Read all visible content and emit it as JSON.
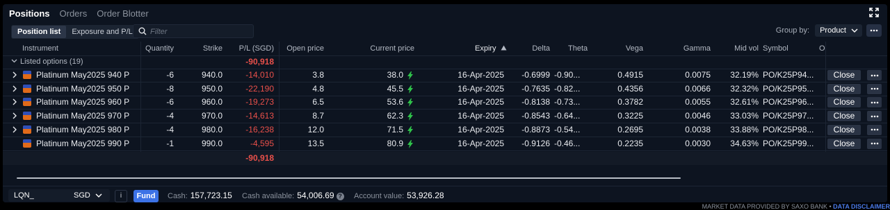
{
  "tabs": [
    "Positions",
    "Orders",
    "Order Blotter"
  ],
  "toolbar": {
    "segments": [
      "Position list",
      "Exposure and P/L"
    ],
    "filter_placeholder": "Filter",
    "group_by_label": "Group by:",
    "group_by_value": "Product"
  },
  "columns": {
    "instrument": "Instrument",
    "quantity": "Quantity",
    "strike": "Strike",
    "pl": "P/L (SGD)",
    "open_price": "Open price",
    "current_price": "Current price",
    "expiry": "Expiry",
    "delta": "Delta",
    "theta": "Theta",
    "vega": "Vega",
    "gamma": "Gamma",
    "mid_vol": "Mid vol",
    "symbol": "Symbol",
    "extra": "O"
  },
  "group": {
    "label": "Listed options (19)",
    "pl": "-90,918"
  },
  "rows": [
    {
      "instrument": "Platinum May2025 940 P",
      "quantity": "-6",
      "strike": "940.0",
      "pl": "-14,010",
      "open": "3.8",
      "current": "38.0",
      "expiry": "16-Apr-2025",
      "delta": "-0.6999",
      "theta": "-0.90...",
      "vega": "0.4915",
      "gamma": "0.0075",
      "midvol": "32.19%",
      "symbol": "PO/K25P94...",
      "close": "Close"
    },
    {
      "instrument": "Platinum May2025 950 P",
      "quantity": "-8",
      "strike": "950.0",
      "pl": "-22,190",
      "open": "4.8",
      "current": "45.5",
      "expiry": "16-Apr-2025",
      "delta": "-0.7635",
      "theta": "-0.82...",
      "vega": "0.4356",
      "gamma": "0.0066",
      "midvol": "32.32%",
      "symbol": "PO/K25P95...",
      "close": "Close"
    },
    {
      "instrument": "Platinum May2025 960 P",
      "quantity": "-6",
      "strike": "960.0",
      "pl": "-19,273",
      "open": "6.5",
      "current": "53.6",
      "expiry": "16-Apr-2025",
      "delta": "-0.8138",
      "theta": "-0.73...",
      "vega": "0.3782",
      "gamma": "0.0055",
      "midvol": "32.61%",
      "symbol": "PO/K25P96...",
      "close": "Close"
    },
    {
      "instrument": "Platinum May2025 970 P",
      "quantity": "-4",
      "strike": "970.0",
      "pl": "-14,613",
      "open": "8.7",
      "current": "62.3",
      "expiry": "16-Apr-2025",
      "delta": "-0.8543",
      "theta": "-0.64...",
      "vega": "0.3225",
      "gamma": "0.0046",
      "midvol": "33.03%",
      "symbol": "PO/K25P97...",
      "close": "Close"
    },
    {
      "instrument": "Platinum May2025 980 P",
      "quantity": "-4",
      "strike": "980.0",
      "pl": "-16,238",
      "open": "12.0",
      "current": "71.5",
      "expiry": "16-Apr-2025",
      "delta": "-0.8873",
      "theta": "-0.54...",
      "vega": "0.2695",
      "gamma": "0.0038",
      "midvol": "33.88%",
      "symbol": "PO/K25P98...",
      "close": "Close"
    },
    {
      "instrument": "Platinum May2025 990 P",
      "quantity": "-1",
      "strike": "990.0",
      "pl": "-4,595",
      "open": "13.5",
      "current": "80.9",
      "expiry": "16-Apr-2025",
      "delta": "-0.9126",
      "theta": "-0.46...",
      "vega": "0.2235",
      "gamma": "0.0030",
      "midvol": "34.63%",
      "symbol": "PO/K25P99...",
      "close": "Close"
    }
  ],
  "total_pl": "-90,918",
  "footer": {
    "account_id": "LQN_",
    "currency": "SGD",
    "info_label": "i",
    "fund_label": "Fund",
    "cash_label": "Cash:",
    "cash_value": "157,723.15",
    "cash_available_label": "Cash available:",
    "cash_available_value": "54,006.69",
    "account_value_label": "Account value:",
    "account_value_value": "53,926.28"
  },
  "disclaimer": {
    "text": "MARKET DATA PROVIDED BY SAXO BANK •",
    "link": "DATA DISCLAIMER"
  },
  "colors": {
    "negative": "#e9504a",
    "accent": "#3c72e6",
    "up_bolt": "#2fc24a"
  },
  "icons": [
    "expand-icon",
    "search-icon",
    "chevron-down-icon",
    "more-icon",
    "chevron-right-icon",
    "instrument-badge-icon",
    "lightning-icon",
    "question-icon"
  ]
}
